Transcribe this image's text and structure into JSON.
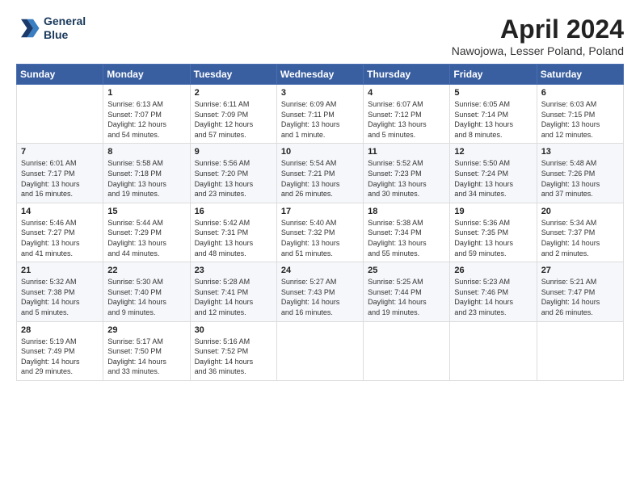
{
  "logo": {
    "line1": "General",
    "line2": "Blue"
  },
  "title": "April 2024",
  "location": "Nawojowa, Lesser Poland, Poland",
  "days_header": [
    "Sunday",
    "Monday",
    "Tuesday",
    "Wednesday",
    "Thursday",
    "Friday",
    "Saturday"
  ],
  "weeks": [
    [
      {
        "day": "",
        "info": ""
      },
      {
        "day": "1",
        "info": "Sunrise: 6:13 AM\nSunset: 7:07 PM\nDaylight: 12 hours\nand 54 minutes."
      },
      {
        "day": "2",
        "info": "Sunrise: 6:11 AM\nSunset: 7:09 PM\nDaylight: 12 hours\nand 57 minutes."
      },
      {
        "day": "3",
        "info": "Sunrise: 6:09 AM\nSunset: 7:11 PM\nDaylight: 13 hours\nand 1 minute."
      },
      {
        "day": "4",
        "info": "Sunrise: 6:07 AM\nSunset: 7:12 PM\nDaylight: 13 hours\nand 5 minutes."
      },
      {
        "day": "5",
        "info": "Sunrise: 6:05 AM\nSunset: 7:14 PM\nDaylight: 13 hours\nand 8 minutes."
      },
      {
        "day": "6",
        "info": "Sunrise: 6:03 AM\nSunset: 7:15 PM\nDaylight: 13 hours\nand 12 minutes."
      }
    ],
    [
      {
        "day": "7",
        "info": "Sunrise: 6:01 AM\nSunset: 7:17 PM\nDaylight: 13 hours\nand 16 minutes."
      },
      {
        "day": "8",
        "info": "Sunrise: 5:58 AM\nSunset: 7:18 PM\nDaylight: 13 hours\nand 19 minutes."
      },
      {
        "day": "9",
        "info": "Sunrise: 5:56 AM\nSunset: 7:20 PM\nDaylight: 13 hours\nand 23 minutes."
      },
      {
        "day": "10",
        "info": "Sunrise: 5:54 AM\nSunset: 7:21 PM\nDaylight: 13 hours\nand 26 minutes."
      },
      {
        "day": "11",
        "info": "Sunrise: 5:52 AM\nSunset: 7:23 PM\nDaylight: 13 hours\nand 30 minutes."
      },
      {
        "day": "12",
        "info": "Sunrise: 5:50 AM\nSunset: 7:24 PM\nDaylight: 13 hours\nand 34 minutes."
      },
      {
        "day": "13",
        "info": "Sunrise: 5:48 AM\nSunset: 7:26 PM\nDaylight: 13 hours\nand 37 minutes."
      }
    ],
    [
      {
        "day": "14",
        "info": "Sunrise: 5:46 AM\nSunset: 7:27 PM\nDaylight: 13 hours\nand 41 minutes."
      },
      {
        "day": "15",
        "info": "Sunrise: 5:44 AM\nSunset: 7:29 PM\nDaylight: 13 hours\nand 44 minutes."
      },
      {
        "day": "16",
        "info": "Sunrise: 5:42 AM\nSunset: 7:31 PM\nDaylight: 13 hours\nand 48 minutes."
      },
      {
        "day": "17",
        "info": "Sunrise: 5:40 AM\nSunset: 7:32 PM\nDaylight: 13 hours\nand 51 minutes."
      },
      {
        "day": "18",
        "info": "Sunrise: 5:38 AM\nSunset: 7:34 PM\nDaylight: 13 hours\nand 55 minutes."
      },
      {
        "day": "19",
        "info": "Sunrise: 5:36 AM\nSunset: 7:35 PM\nDaylight: 13 hours\nand 59 minutes."
      },
      {
        "day": "20",
        "info": "Sunrise: 5:34 AM\nSunset: 7:37 PM\nDaylight: 14 hours\nand 2 minutes."
      }
    ],
    [
      {
        "day": "21",
        "info": "Sunrise: 5:32 AM\nSunset: 7:38 PM\nDaylight: 14 hours\nand 5 minutes."
      },
      {
        "day": "22",
        "info": "Sunrise: 5:30 AM\nSunset: 7:40 PM\nDaylight: 14 hours\nand 9 minutes."
      },
      {
        "day": "23",
        "info": "Sunrise: 5:28 AM\nSunset: 7:41 PM\nDaylight: 14 hours\nand 12 minutes."
      },
      {
        "day": "24",
        "info": "Sunrise: 5:27 AM\nSunset: 7:43 PM\nDaylight: 14 hours\nand 16 minutes."
      },
      {
        "day": "25",
        "info": "Sunrise: 5:25 AM\nSunset: 7:44 PM\nDaylight: 14 hours\nand 19 minutes."
      },
      {
        "day": "26",
        "info": "Sunrise: 5:23 AM\nSunset: 7:46 PM\nDaylight: 14 hours\nand 23 minutes."
      },
      {
        "day": "27",
        "info": "Sunrise: 5:21 AM\nSunset: 7:47 PM\nDaylight: 14 hours\nand 26 minutes."
      }
    ],
    [
      {
        "day": "28",
        "info": "Sunrise: 5:19 AM\nSunset: 7:49 PM\nDaylight: 14 hours\nand 29 minutes."
      },
      {
        "day": "29",
        "info": "Sunrise: 5:17 AM\nSunset: 7:50 PM\nDaylight: 14 hours\nand 33 minutes."
      },
      {
        "day": "30",
        "info": "Sunrise: 5:16 AM\nSunset: 7:52 PM\nDaylight: 14 hours\nand 36 minutes."
      },
      {
        "day": "",
        "info": ""
      },
      {
        "day": "",
        "info": ""
      },
      {
        "day": "",
        "info": ""
      },
      {
        "day": "",
        "info": ""
      }
    ]
  ]
}
